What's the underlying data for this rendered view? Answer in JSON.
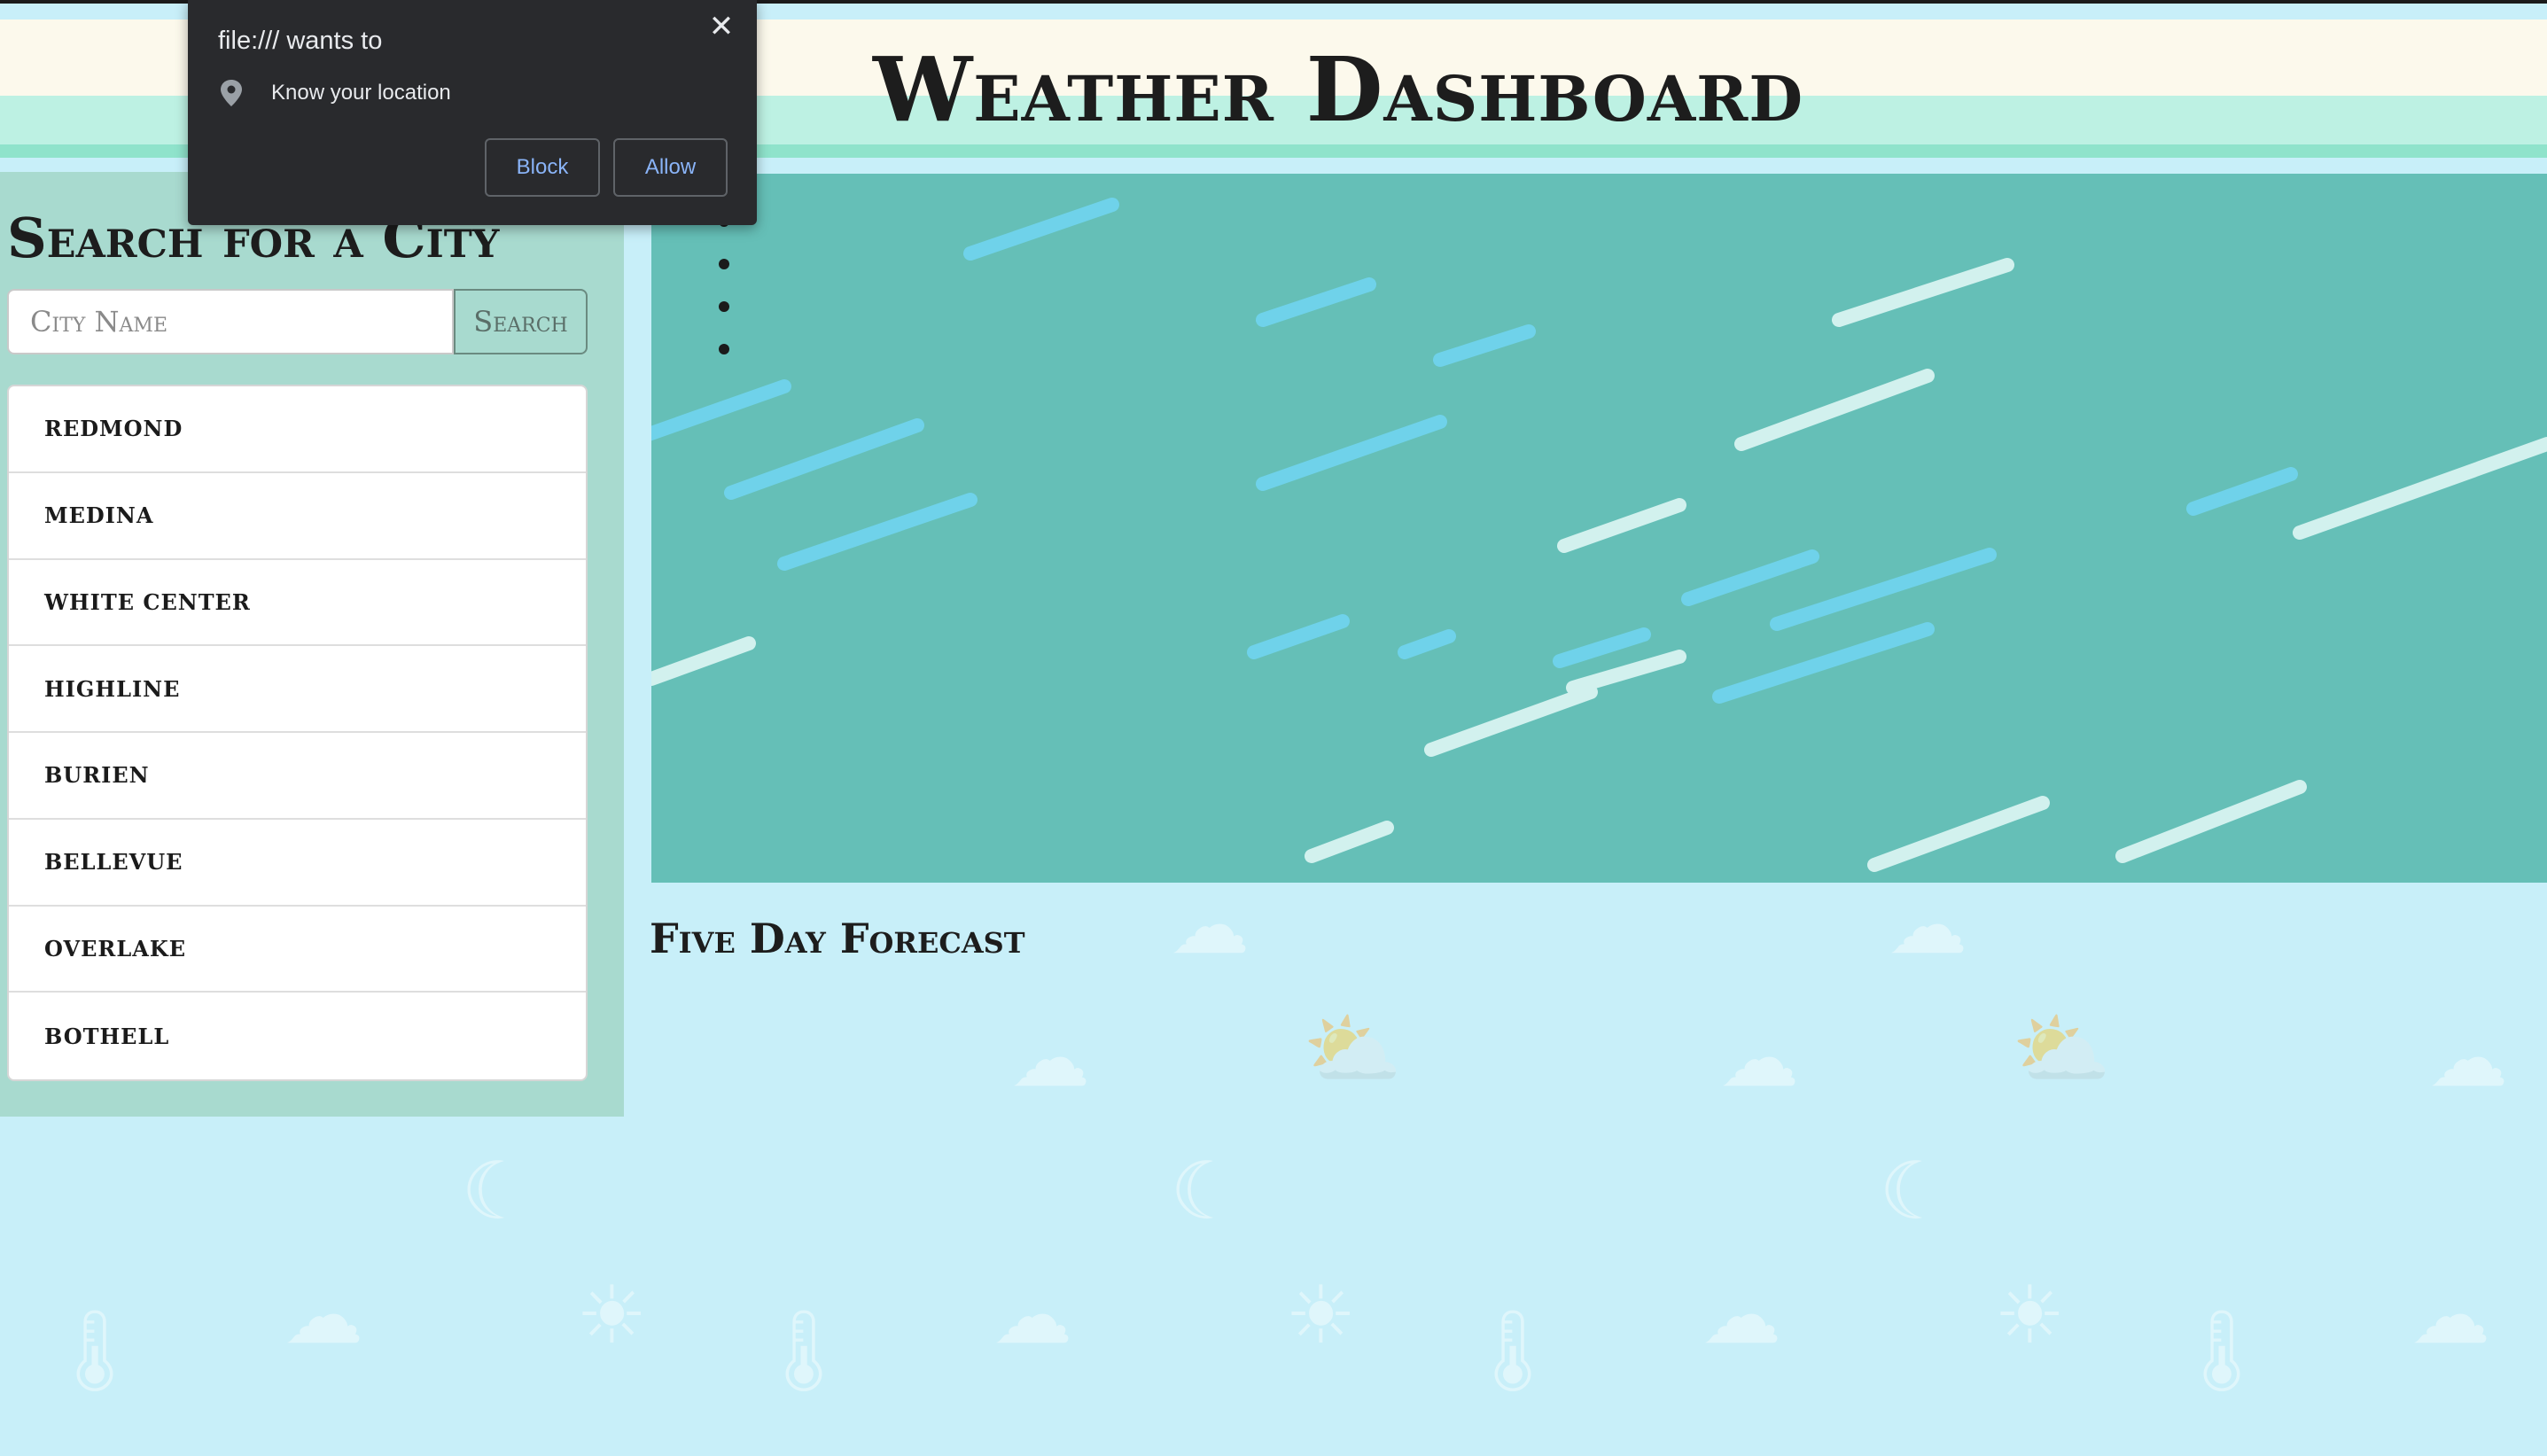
{
  "header": {
    "title": "Weather Dashboard"
  },
  "sidebar": {
    "heading": "Search for a City",
    "search_input": {
      "placeholder": "City Name",
      "value": ""
    },
    "search_button": "Search",
    "cities": [
      "REDMOND",
      "MEDINA",
      "WHITE CENTER",
      "HIGHLINE",
      "BURIEN",
      "BELLEVUE",
      "OVERLAKE",
      "BOTHELL"
    ]
  },
  "current_weather": {
    "bullet_count": 4
  },
  "forecast": {
    "heading": "Five Day Forecast"
  },
  "permission_popup": {
    "title": "file:/// wants to",
    "permission": "Know your location",
    "block_label": "Block",
    "allow_label": "Allow",
    "close_icon": "close-icon",
    "permission_icon": "location-pin-icon"
  },
  "colors": {
    "page_bg": "#c8eff9",
    "sidebar_bg": "#a8dacf",
    "panel_bg": "#65bfb7",
    "popup_bg": "#292a2d",
    "popup_link": "#8ab4f8"
  }
}
